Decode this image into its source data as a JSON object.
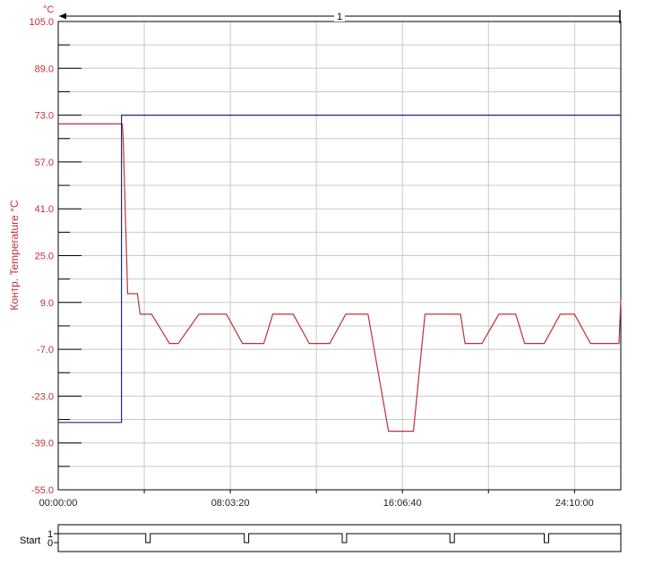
{
  "chart_data": {
    "type": "line",
    "y_unit": "°C",
    "ylabel": "Контр. Temperature °C",
    "ylim": [
      -55.0,
      105.0
    ],
    "y_tick_labels": [
      "105.0",
      "89.0",
      "73.0",
      "57.0",
      "41.0",
      "25.0",
      "9.0",
      "-7.0",
      "-23.0",
      "-39.0",
      "-55.0"
    ],
    "y_ticks": [
      105,
      89,
      73,
      57,
      41,
      25,
      9,
      -7,
      -23,
      -39,
      -55
    ],
    "xlim_seconds": [
      0,
      94800
    ],
    "x_tick_labels": [
      "00:00:00",
      "08:03:20",
      "16:06:40",
      "24:10:00"
    ],
    "x_ticks_seconds": [
      0,
      29000,
      58000,
      87000
    ],
    "grid": true,
    "marker_label": "1",
    "series": [
      {
        "color": "#c0303a",
        "x_seconds": [
          0,
          10800,
          10950,
          11700,
          13350,
          13800,
          15750,
          18750,
          20250,
          23700,
          25200,
          28350,
          31050,
          34650,
          36150,
          39600,
          42300,
          45750,
          48450,
          52200,
          55650,
          59850,
          61800,
          64800,
          67800,
          68550,
          71400,
          74250,
          77100,
          78600,
          81900,
          84600,
          87000,
          89700,
          90600,
          94500,
          94800
        ],
        "y": [
          70,
          70,
          65,
          12,
          12,
          5,
          5,
          -5,
          -5,
          5,
          5,
          5,
          -5,
          -5,
          5,
          5,
          -5,
          -5,
          5,
          5,
          -35,
          -35,
          5,
          5,
          5,
          -5,
          -5,
          5,
          5,
          -5,
          -5,
          5,
          5,
          -5,
          -5,
          -5,
          10
        ]
      },
      {
        "color": "#1a2a8a",
        "x_seconds": [
          0,
          10650,
          10650,
          94800
        ],
        "y": [
          -32,
          -32,
          73,
          73
        ]
      }
    ]
  },
  "signal": {
    "label": "Start",
    "level_labels": [
      "1",
      "0"
    ],
    "pulses_seconds": [
      [
        14750,
        15500
      ],
      [
        31350,
        32100
      ],
      [
        47850,
        48600
      ],
      [
        66000,
        66750
      ],
      [
        81900,
        82650
      ]
    ]
  }
}
